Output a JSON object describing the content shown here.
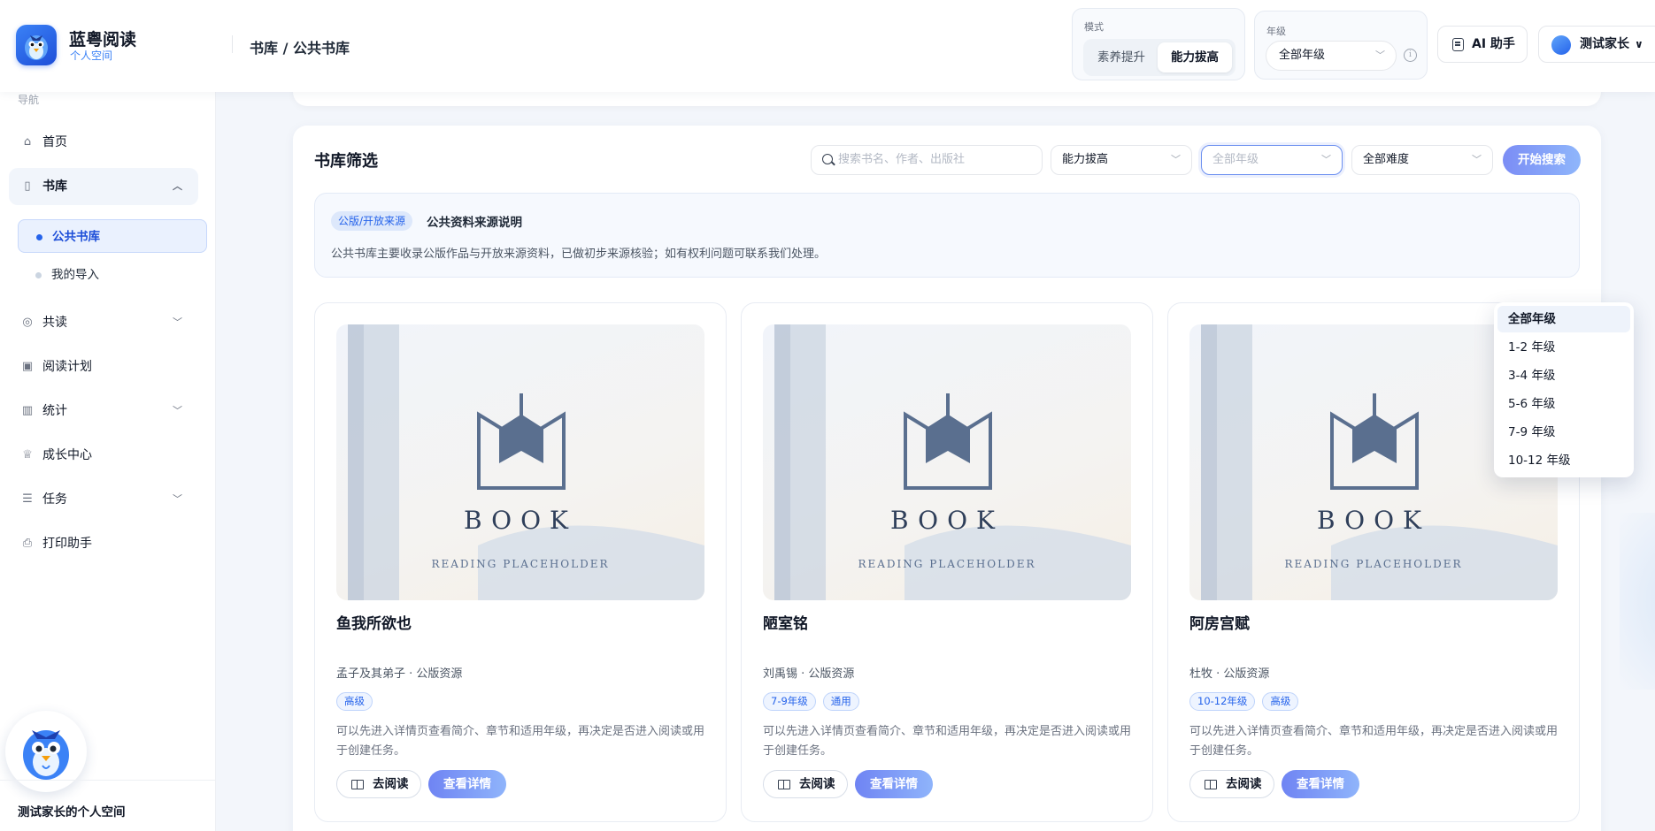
{
  "app": {
    "name": "蓝粤阅读",
    "subtitle": "个人空间",
    "breadcrumb": "书库 / 公共书库"
  },
  "header": {
    "mode": {
      "label": "模式",
      "options": [
        "素养提升",
        "能力拔高"
      ],
      "selected": "能力拔高"
    },
    "grade": {
      "label": "年级",
      "value": "全部年级"
    },
    "ai_button": "AI 助手",
    "user_button": "测试家长"
  },
  "sidebar": {
    "caption": "导航",
    "items": [
      {
        "label": "首页",
        "icon": "home-icon"
      },
      {
        "label": "书库",
        "icon": "book-icon",
        "expanded": true
      },
      {
        "label": "共读",
        "icon": "compass-icon"
      },
      {
        "label": "阅读计划",
        "icon": "calendar-icon"
      },
      {
        "label": "统计",
        "icon": "chart-icon"
      },
      {
        "label": "成长中心",
        "icon": "trophy-icon"
      },
      {
        "label": "任务",
        "icon": "task-icon"
      },
      {
        "label": "打印助手",
        "icon": "printer-icon"
      }
    ],
    "sub_items": [
      {
        "label": "公共书库",
        "active": true
      },
      {
        "label": "我的导入",
        "active": false
      }
    ],
    "space_name": "测试家长的个人空间"
  },
  "filter": {
    "title": "书库筛选",
    "search_placeholder": "搜索书名、作者、出版社",
    "ability": "能力拔高",
    "grade_placeholder": "全部年级",
    "difficulty": "全部难度",
    "start_button": "开始搜索"
  },
  "notice": {
    "badge": "公版/开放来源",
    "title": "公共资料来源说明",
    "desc": "公共书库主要收录公版作品与开放来源资料，已做初步来源核验；如有权利问题可联系我们处理。"
  },
  "grade_dropdown": {
    "options": [
      "全部年级",
      "1-2 年级",
      "3-4 年级",
      "5-6 年级",
      "7-9 年级",
      "10-12 年级"
    ],
    "selected": "全部年级"
  },
  "cover": {
    "title": "BOOK",
    "subtitle": "READING PLACEHOLDER"
  },
  "books": [
    {
      "title": "鱼我所欲也",
      "meta": "孟子及其弟子 · 公版资源",
      "tags": [
        "高级"
      ],
      "desc": "可以先进入详情页查看简介、章节和适用年级，再决定是否进入阅读或用于创建任务。",
      "read_label": "去阅读",
      "detail_label": "查看详情"
    },
    {
      "title": "陋室铭",
      "meta": "刘禹锡 · 公版资源",
      "tags": [
        "7-9年级",
        "通用"
      ],
      "desc": "可以先进入详情页查看简介、章节和适用年级，再决定是否进入阅读或用于创建任务。",
      "read_label": "去阅读",
      "detail_label": "查看详情"
    },
    {
      "title": "阿房宫赋",
      "meta": "杜牧 · 公版资源",
      "tags": [
        "10-12年级",
        "高级"
      ],
      "desc": "可以先进入详情页查看简介、章节和适用年级，再决定是否进入阅读或用于创建任务。",
      "read_label": "去阅读",
      "detail_label": "查看详情"
    }
  ],
  "colors": {
    "accent": "#2563eb",
    "button_gradient_start": "#6f84f3",
    "button_gradient_end": "#8fb4fb",
    "cover_icon": "#5a6f8f"
  }
}
